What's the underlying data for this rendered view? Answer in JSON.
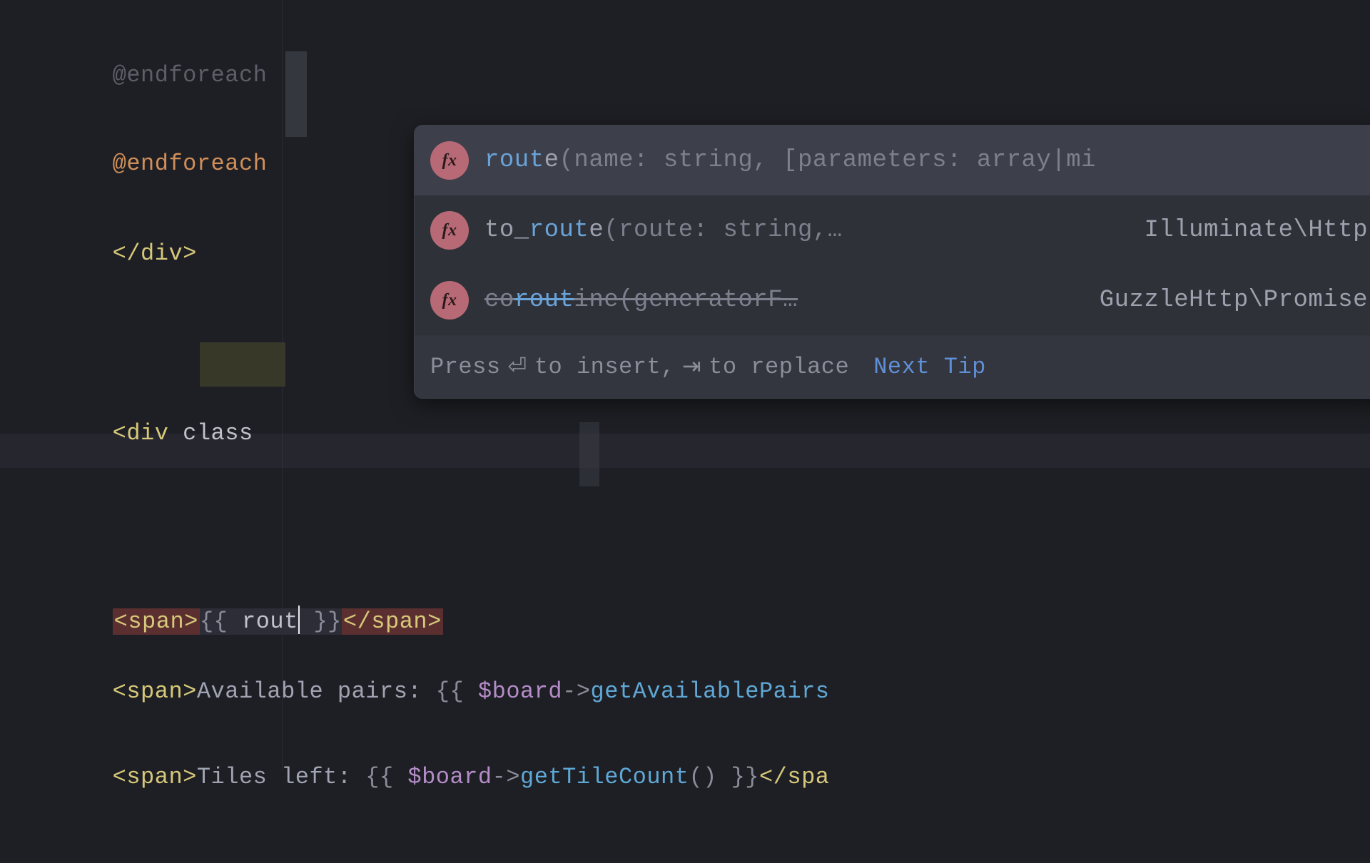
{
  "code": {
    "line0": "@endforeach",
    "line1": "@endforeach",
    "line2": "</div>",
    "line3_open": "<div",
    "line3_attr": "class",
    "line4_tag_open": "<span>",
    "line4_open": "{{ ",
    "line4_typed": "rout",
    "line4_close": " }}",
    "line4_tag_close": "</span>",
    "line5_tag_open": "<span>",
    "line5_text": "Available pairs: ",
    "line5_open": "{{ ",
    "line5_var": "$board",
    "line5_arrow": "->",
    "line5_method": "getAvailablePairs",
    "line6_tag_open": "<span>",
    "line6_text": "Tiles left: ",
    "line6_open": "{{ ",
    "line6_var": "$board",
    "line6_arrow": "->",
    "line6_method": "getTileCount",
    "line6_call": "()",
    "line6_close": " }}",
    "line6_tag_close": "</spa"
  },
  "popup": {
    "items": [
      {
        "badge": "fx",
        "name_match": "rout",
        "name_rest": "e",
        "sig": "(name: string, [parameters: array|mi",
        "origin": "",
        "deprecated": false
      },
      {
        "badge": "fx",
        "name_pre": "to_",
        "name_match": "rout",
        "name_rest": "e",
        "sig": "(route: string,…",
        "origin": "Illuminate\\Http",
        "deprecated": false
      },
      {
        "badge": "fx",
        "name_pre": "co",
        "name_match": "rout",
        "name_rest": "ine",
        "sig": "(generatorF…",
        "origin": "GuzzleHttp\\Promise",
        "deprecated": true
      }
    ],
    "hint_pre": "Press ",
    "hint_key1": "⏎",
    "hint_mid1": " to insert, ",
    "hint_key2": "⇥",
    "hint_mid2": " to replace",
    "next_tip": "Next Tip"
  }
}
